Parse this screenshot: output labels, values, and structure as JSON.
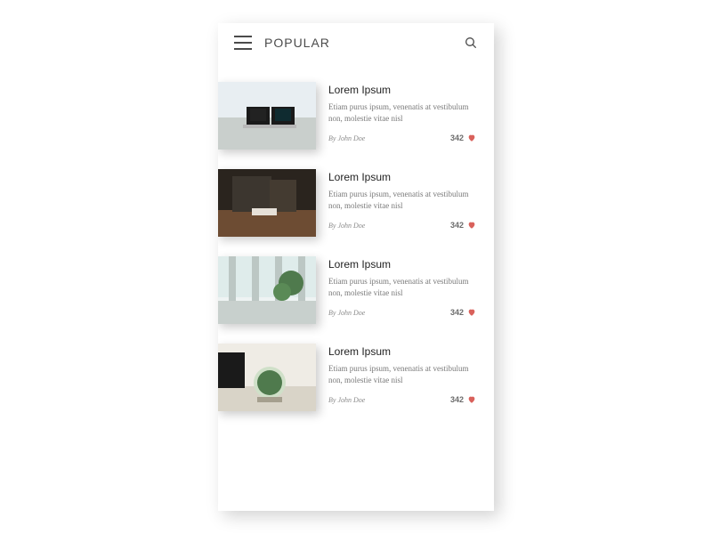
{
  "header": {
    "title": "POPULAR"
  },
  "colors": {
    "heart": "#d9615b",
    "text_soft": "#7a7a7a"
  },
  "cards": [
    {
      "title": "Lorem Ipsum",
      "desc": "Etiam purus ipsum, venenatis at vestibulum non, molestie vitae nisl",
      "author": "By John Doe",
      "likes": "342"
    },
    {
      "title": "Lorem Ipsum",
      "desc": "Etiam purus ipsum, venenatis at vestibulum non, molestie vitae nisl",
      "author": "By John Doe",
      "likes": "342"
    },
    {
      "title": "Lorem Ipsum",
      "desc": "Etiam purus ipsum, venenatis at vestibulum non, molestie vitae nisl",
      "author": "By John Doe",
      "likes": "342"
    },
    {
      "title": "Lorem Ipsum",
      "desc": "Etiam purus ipsum, venenatis at vestibulum non, molestie vitae nisl",
      "author": "By John Doe",
      "likes": "342"
    }
  ]
}
